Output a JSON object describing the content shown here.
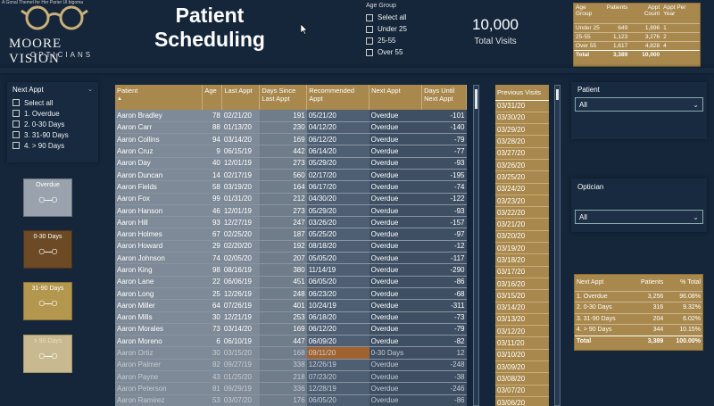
{
  "top_caption": "A Gonal Themel for Her Parier Ul bigoma",
  "logo": {
    "line1": "MOORE VISION",
    "line2": "OPTICIANS"
  },
  "title": {
    "line1": "Patient",
    "line2": "Scheduling"
  },
  "age_slicer": {
    "title": "Age Group",
    "options": [
      "Select all",
      "Under 25",
      "25-55",
      "Over 55"
    ]
  },
  "kpi": {
    "value": "10,000",
    "label": "Total Visits"
  },
  "age_table": {
    "headers": [
      "Age Group",
      "Patients",
      "Appt Count",
      "Appt Per Year"
    ],
    "rows": [
      [
        "Under 25",
        "649",
        "1,896",
        "1"
      ],
      [
        "25-55",
        "1,123",
        "3,276",
        "2"
      ],
      [
        "Over 55",
        "1,617",
        "4,828",
        "4"
      ]
    ],
    "total": [
      "Total",
      "3,389",
      "10,000",
      ""
    ]
  },
  "next_slicer": {
    "title": "Next Appt",
    "options": [
      "Select all",
      "1. Overdue",
      "2. 0-30 Days",
      "3. 31-90 Days",
      "4. > 90 Days"
    ]
  },
  "tiles": [
    {
      "label": "Overdue",
      "icon": "glasses-icon"
    },
    {
      "label": "0-30 Days",
      "icon": "glasses-icon"
    },
    {
      "label": "31-90 Days",
      "icon": "glasses-icon"
    },
    {
      "label": "> 90 Days",
      "icon": "glasses-icon"
    }
  ],
  "main_table": {
    "headers": [
      "Patient",
      "Age",
      "Last Appt",
      "Days Since Last Appt",
      "Recommended Appt",
      "Next Appt",
      "Days Until Next Appt"
    ],
    "rows": [
      [
        "Aaron Bradley",
        "78",
        "02/21/20",
        "191",
        "05/21/20",
        "Overdue",
        "-101"
      ],
      [
        "Aaron Carr",
        "88",
        "01/13/20",
        "230",
        "04/12/20",
        "Overdue",
        "-140"
      ],
      [
        "Aaron Collins",
        "94",
        "03/14/20",
        "169",
        "06/12/20",
        "Overdue",
        "-79"
      ],
      [
        "Aaron Cruz",
        "9",
        "06/15/19",
        "442",
        "06/14/20",
        "Overdue",
        "-77"
      ],
      [
        "Aaron Day",
        "40",
        "12/01/19",
        "273",
        "05/29/20",
        "Overdue",
        "-93"
      ],
      [
        "Aaron Duncan",
        "14",
        "02/17/19",
        "560",
        "02/17/20",
        "Overdue",
        "-195"
      ],
      [
        "Aaron Fields",
        "58",
        "03/19/20",
        "164",
        "06/17/20",
        "Overdue",
        "-74"
      ],
      [
        "Aaron Fox",
        "99",
        "01/31/20",
        "212",
        "04/30/20",
        "Overdue",
        "-122"
      ],
      [
        "Aaron Hanson",
        "46",
        "12/01/19",
        "273",
        "05/29/20",
        "Overdue",
        "-93"
      ],
      [
        "Aaron Hill",
        "93",
        "12/27/19",
        "247",
        "03/26/20",
        "Overdue",
        "-157"
      ],
      [
        "Aaron Holmes",
        "67",
        "02/25/20",
        "187",
        "05/25/20",
        "Overdue",
        "-97"
      ],
      [
        "Aaron Howard",
        "29",
        "02/20/20",
        "192",
        "08/18/20",
        "Overdue",
        "-12"
      ],
      [
        "Aaron Johnson",
        "74",
        "02/05/20",
        "207",
        "05/05/20",
        "Overdue",
        "-117"
      ],
      [
        "Aaron King",
        "98",
        "08/16/19",
        "380",
        "11/14/19",
        "Overdue",
        "-290"
      ],
      [
        "Aaron Lane",
        "22",
        "06/06/19",
        "451",
        "06/05/20",
        "Overdue",
        "-86"
      ],
      [
        "Aaron Long",
        "25",
        "12/26/19",
        "248",
        "06/23/20",
        "Overdue",
        "-68"
      ],
      [
        "Aaron Miller",
        "64",
        "07/26/19",
        "401",
        "10/24/19",
        "Overdue",
        "-311"
      ],
      [
        "Aaron Mills",
        "30",
        "12/21/19",
        "253",
        "06/18/20",
        "Overdue",
        "-73"
      ],
      [
        "Aaron Morales",
        "73",
        "03/14/20",
        "169",
        "06/12/20",
        "Overdue",
        "-79"
      ],
      [
        "Aaron Moreno",
        "6",
        "06/10/19",
        "447",
        "06/09/20",
        "Overdue",
        "-82"
      ],
      [
        "Aaron Ortiz",
        "30",
        "03/15/20",
        "168",
        "09/11/20",
        "0-30 Days",
        "12"
      ],
      [
        "Aaron Palmer",
        "82",
        "09/27/19",
        "338",
        "12/26/19",
        "Overdue",
        "-248"
      ],
      [
        "Aaron Payne",
        "43",
        "01/25/20",
        "218",
        "07/23/20",
        "Overdue",
        "-38"
      ],
      [
        "Aaron Peterson",
        "81",
        "09/29/19",
        "336",
        "12/28/19",
        "Overdue",
        "-246"
      ],
      [
        "Aaron Ramirez",
        "53",
        "03/07/20",
        "176",
        "06/05/20",
        "Overdue",
        "-86"
      ]
    ]
  },
  "prev_visits": {
    "header": "Previous Visits",
    "values": [
      "03/31/20",
      "03/30/20",
      "03/29/20",
      "03/28/20",
      "03/27/20",
      "03/26/20",
      "03/25/20",
      "03/24/20",
      "03/23/20",
      "03/22/20",
      "03/21/20",
      "03/20/20",
      "03/19/20",
      "03/18/20",
      "03/17/20",
      "03/16/20",
      "03/15/20",
      "03/14/20",
      "03/13/20",
      "03/12/20",
      "03/11/20",
      "03/10/20",
      "03/09/20",
      "03/08/20",
      "03/07/20",
      "03/06/20"
    ]
  },
  "patient_dd": {
    "label": "Patient",
    "value": "All"
  },
  "optician_dd": {
    "label": "Optician",
    "value": "All"
  },
  "next_table": {
    "headers": [
      "Next Appt",
      "Patients",
      "% Total"
    ],
    "rows": [
      [
        "1. Overdue",
        "3,256",
        "96.08%"
      ],
      [
        "2. 0-30 Days",
        "316",
        "9.32%"
      ],
      [
        "3. 31-90 Days",
        "204",
        "6.02%"
      ],
      [
        "4. > 90 Days",
        "344",
        "10.15%"
      ]
    ],
    "total": [
      "Total",
      "3,389",
      "100.00%"
    ]
  },
  "colors": {
    "background": "#15263a",
    "gold": "#a8884c",
    "row_grey": "#7e8a97",
    "row_blue": "#4e5f73",
    "highlight": "#a0622e"
  }
}
